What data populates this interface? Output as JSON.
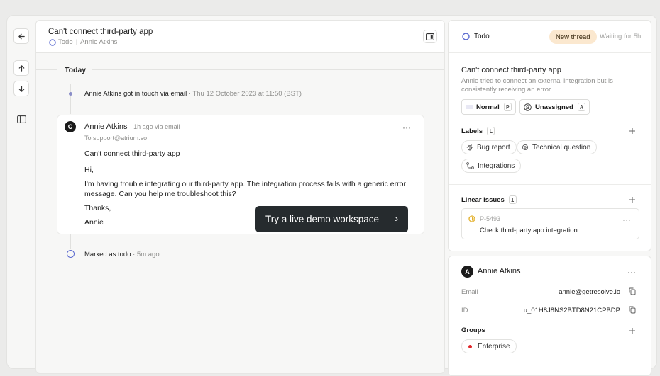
{
  "thread": {
    "title": "Can't connect third-party app",
    "status": "Todo",
    "assignee": "Annie Atkins"
  },
  "timeline": {
    "day_label": "Today",
    "event1_actor": "Annie Atkins",
    "event1_text": "got in touch via email",
    "event1_time": "· Thu 12 October 2023 at 11:50 (BST)",
    "event2_text": "Marked as todo",
    "event2_time": "· 5m ago"
  },
  "message": {
    "avatar_letter": "C",
    "sender": "Annie Atkins",
    "meta": "· 1h ago via email",
    "to": "To support@atrium.so",
    "subject": "Can't connect third-party app",
    "greeting": "Hi,",
    "body": "I'm having trouble integrating our third-party app. The integration process fails with a generic error message. Can you help me troubleshoot this?",
    "thanks": "Thanks,",
    "signature": "Annie"
  },
  "demo_button": {
    "label": "Try a live demo workspace",
    "arrow": "›"
  },
  "side": {
    "status": "Todo",
    "new_thread_badge": "New thread",
    "waiting": "Waiting for 5h",
    "title": "Can't connect third-party app",
    "description": "Annie tried to connect an external integration but is consistently receiving an error.",
    "priority_label": "Normal",
    "priority_key": "P",
    "assign_label": "Unassigned",
    "assign_key": "A",
    "labels_heading": "Labels",
    "labels_key": "L",
    "labels": [
      "Bug report",
      "Technical question",
      "Integrations"
    ],
    "linear_heading": "Linear issues",
    "linear_key": "I",
    "issue_id": "P-5493",
    "issue_title": "Check third-party app integration"
  },
  "contact": {
    "avatar_letter": "A",
    "name": "Annie Atkins",
    "email_label": "Email",
    "email": "annie@getresolve.io",
    "id_label": "ID",
    "id": "u_01H8J8NS2BTD8N21CPBDP",
    "groups_heading": "Groups",
    "group": "Enterprise"
  },
  "colors": {
    "todo_ring": "#5b6ad0",
    "badge_bg": "#fbe8cf",
    "dark_button": "#262b2e",
    "issue_ring": "#e3b02b",
    "group_dot": "#e0272a"
  }
}
